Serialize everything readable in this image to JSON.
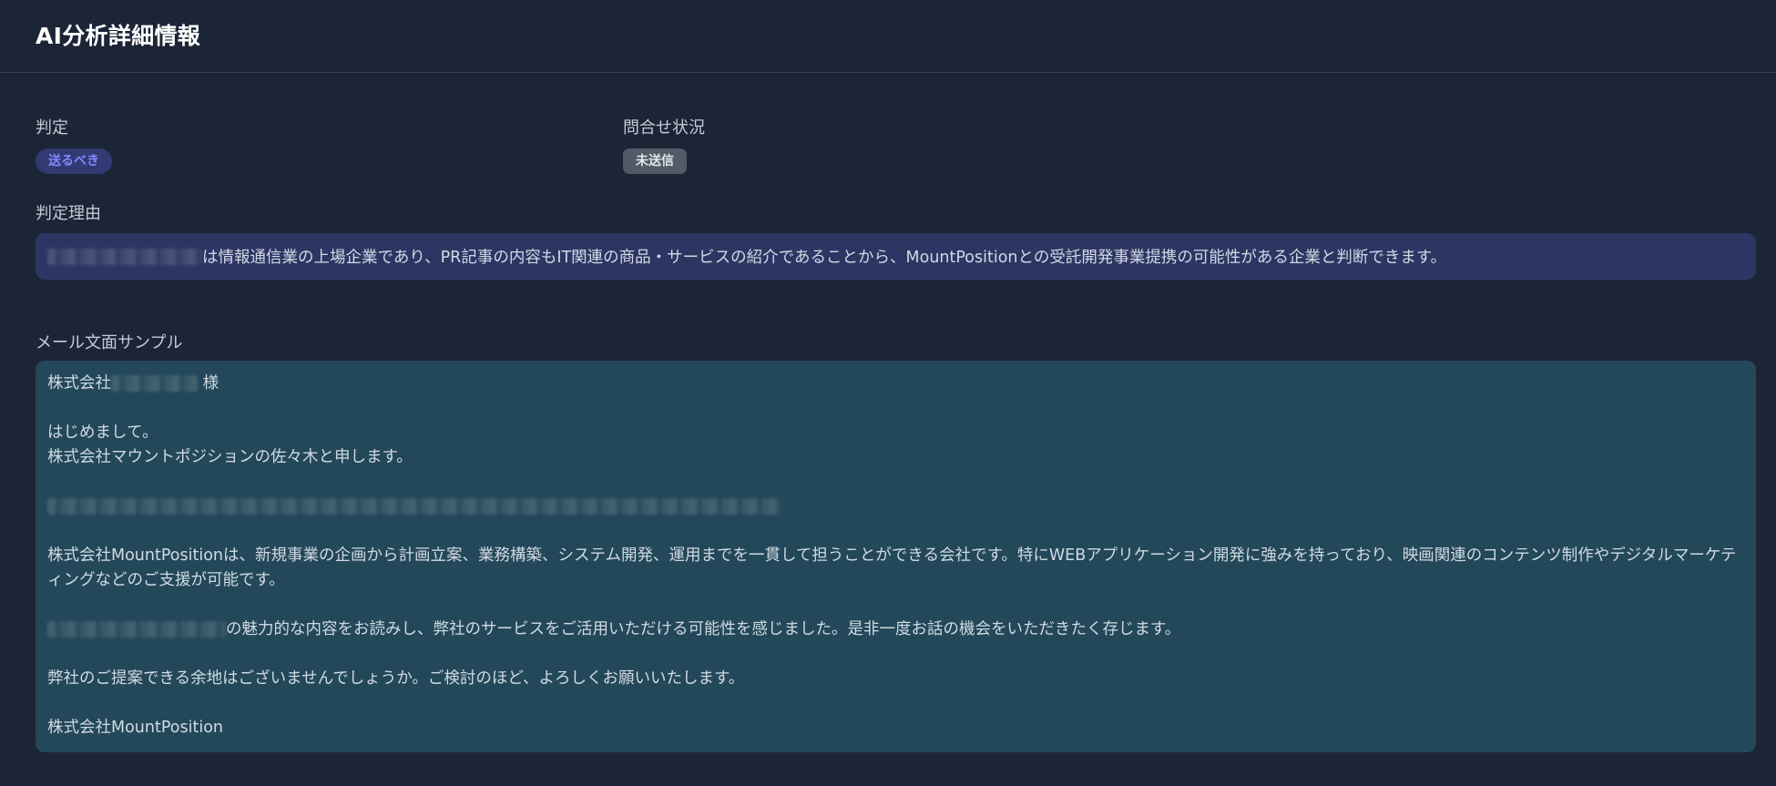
{
  "header": {
    "title": "AI分析詳細情報"
  },
  "judgement": {
    "label": "判定",
    "badge": "送るべき"
  },
  "inquiry_status": {
    "label": "問合せ状況",
    "badge": "未送信"
  },
  "reason": {
    "label": "判定理由",
    "text": "は情報通信業の上場企業であり、PR記事の内容もIT関連の商品・サービスの紹介であることから、MountPositionとの受託開発事業提携の可能性がある企業と判断できます。"
  },
  "mail_sample": {
    "label": "メール文面サンプル",
    "greeting_prefix": "株式会社",
    "greeting_suffix": "様",
    "intro_1": "はじめまして。",
    "intro_2": "株式会社マウントポジションの佐々木と申します。",
    "body_1": "株式会社MountPositionは、新規事業の企画から計画立案、業務構築、システム開発、運用までを一貫して担うことができる会社です。特にWEBアプリケーション開発に強みを持っており、映画関連のコンテンツ制作やデジタルマーケティングなどのご支援が可能です。",
    "body_2": "の魅力的な内容をお読みし、弊社のサービスをご活用いただける可能性を感じました。是非一度お話の機会をいただきたく存じます。",
    "body_3": "弊社のご提案できる余地はございませんでしょうか。ご検討のほど、よろしくお願いいたします。",
    "signature": "株式会社MountPosition"
  },
  "colors": {
    "background": "#1c2536",
    "send_badge_bg": "#313a72",
    "send_badge_text": "#8088ff",
    "unsent_badge_bg": "#525a67",
    "reason_box_bg": "#2d3663",
    "mail_box_bg": "#23485a"
  }
}
